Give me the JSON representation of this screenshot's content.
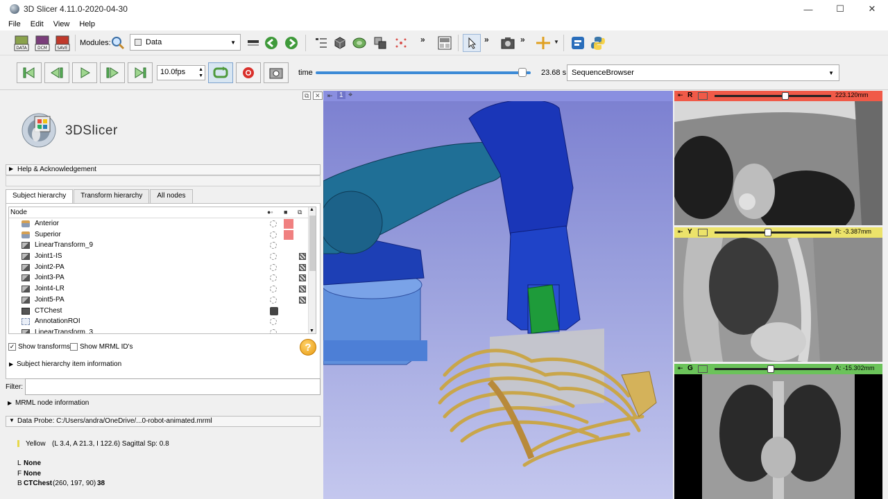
{
  "window": {
    "title": "3D Slicer 4.11.0-2020-04-30",
    "minimize": "—",
    "maximize": "☐",
    "close": "✕"
  },
  "menu": [
    "File",
    "Edit",
    "View",
    "Help"
  ],
  "toolbar": {
    "data_label": "DATA",
    "dcm_label": "DCM",
    "save_label": "SAVE",
    "modules_label": "Modules:",
    "module_selected": "Data",
    "overflow": "»"
  },
  "sequence": {
    "fps": "10.0fps",
    "time_label": "time",
    "time_fraction": 0.96,
    "time_value": "23.68 s",
    "browser": "SequenceBrowser"
  },
  "logo": {
    "text": "3DSlicer"
  },
  "sections": {
    "help": "Help & Acknowledgement",
    "subject_info": "Subject hierarchy item information",
    "mrml_info": "MRML node information",
    "data_probe": "Data Probe: C:/Users/andra/OneDrive/...0-robot-animated.mrml"
  },
  "tabs": [
    "Subject hierarchy",
    "Transform hierarchy",
    "All nodes"
  ],
  "tree": {
    "header": "Node",
    "rows": [
      {
        "label": "Anterior",
        "icon": "markup-icon",
        "color": "#f08080",
        "xf": false
      },
      {
        "label": "Superior",
        "icon": "markup-icon",
        "color": "#f08080",
        "xf": false
      },
      {
        "label": "LinearTransform_9",
        "icon": "transform-icon",
        "color": "",
        "xf": false
      },
      {
        "label": "Joint1-IS",
        "icon": "transform-icon",
        "color": "",
        "xf": true
      },
      {
        "label": "Joint2-PA",
        "icon": "transform-icon",
        "color": "",
        "xf": true
      },
      {
        "label": "Joint3-PA",
        "icon": "transform-icon",
        "color": "",
        "xf": true
      },
      {
        "label": "Joint4-LR",
        "icon": "transform-icon",
        "color": "",
        "xf": true
      },
      {
        "label": "Joint5-PA",
        "icon": "transform-icon",
        "color": "",
        "xf": true
      },
      {
        "label": "CTChest",
        "icon": "volume-icon",
        "color": "",
        "xf": false
      },
      {
        "label": "AnnotationROI",
        "icon": "roi-icon",
        "color": "",
        "xf": false
      },
      {
        "label": "LinearTransform_3",
        "icon": "transform-icon",
        "color": "",
        "xf": false
      }
    ]
  },
  "options": {
    "show_transforms": "Show transforms",
    "show_mrml_ids": "Show MRML ID's"
  },
  "filter": {
    "label": "Filter:"
  },
  "probe": {
    "view": "Yellow",
    "coords": "(L 3.4, A 21.3, I 122.6)  Sagittal Sp: 0.8",
    "l_key": "L",
    "l_val": "None",
    "f_key": "F",
    "f_val": "None",
    "b_key": "B",
    "b_name": "CTChest",
    "b_ijk": "(260, 197,  90)",
    "b_val": "38"
  },
  "view3d": {
    "label": "1"
  },
  "slices": [
    {
      "letter": "R",
      "value": "223.120mm",
      "color": "#f05a48",
      "position": 0.61
    },
    {
      "letter": "Y",
      "value": "R: -3.387mm",
      "color": "#ece36a",
      "position": 0.46
    },
    {
      "letter": "G",
      "value": "A: -15.302mm",
      "color": "#6bc35a",
      "position": 0.48
    }
  ]
}
